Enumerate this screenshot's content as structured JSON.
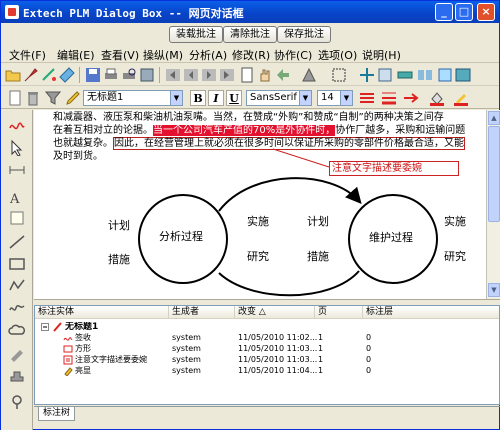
{
  "window": {
    "title": "Extech PLM Dialog Box -- 网页对话框"
  },
  "title_buttons": {
    "minimize": "_",
    "maximize": "□",
    "close": "×"
  },
  "actions": {
    "load": "装载批注",
    "clear": "清除批注",
    "save": "保存批注"
  },
  "menu": [
    "文件(F)",
    "编辑(E)",
    "查看(V)",
    "操纵(M)",
    "分析(A)",
    "修改(R)",
    "协作(C)",
    "选项(O)",
    "说明(H)"
  ],
  "format": {
    "markup_name": "无标题1",
    "font_family": "SansSerif",
    "font_size": "14",
    "bold": "B",
    "italic": "I",
    "underline": "U",
    "dropdown_arrow": "▼"
  },
  "document": {
    "line1": "和减震器、液压泵和柴油机油泵嘴。当然，在赞成“外购”和赞成“自制”的两种决策之间存",
    "line2_a": "在着互相对立的论据。",
    "line2_hl": "当一个公司汽车产值的70%是外协件时，",
    "line2_b": "协作厂越多，采购和运输问题",
    "line3_a": "也就越复杂。",
    "line3_boxed": "因此，在经营管理上就必须在很多时间以保证所采购的零部件价格最合适，又能",
    "line4": "及时到货。",
    "annotation_label": "注意文字描述要委婉",
    "diagram": {
      "left_center": "分析过程",
      "right_center": "维护过程",
      "plan_left": "计划",
      "measure_left": "措施",
      "implement_left": "实施",
      "research_left": "研究",
      "plan_right": "计划",
      "measure_right": "措施",
      "implement_right": "实施",
      "research_right": "研究"
    }
  },
  "table": {
    "headers": [
      "标注实体",
      "生成者",
      "改变 △",
      "页",
      "标注层"
    ],
    "rows": [
      {
        "entity": "无标题1",
        "creator": "",
        "changed": "",
        "page": "",
        "layer": ""
      },
      {
        "entity": "签收",
        "creator": "system",
        "changed": "11/05/2010 11:02...",
        "page": "1",
        "layer": "0"
      },
      {
        "entity": "方形",
        "creator": "system",
        "changed": "11/05/2010 11:03...",
        "page": "1",
        "layer": "0"
      },
      {
        "entity": "注意文字描述要委婉",
        "creator": "system",
        "changed": "11/05/2010 11:03...",
        "page": "1",
        "layer": "0"
      },
      {
        "entity": "亮显",
        "creator": "system",
        "changed": "11/05/2010 11:04...",
        "page": "1",
        "layer": "0"
      }
    ]
  },
  "bottom_tab": "标注树",
  "colors": {
    "accent_red": "#cc1111",
    "highlight": "#e3102e",
    "title_blue": "#0a5fe8"
  }
}
